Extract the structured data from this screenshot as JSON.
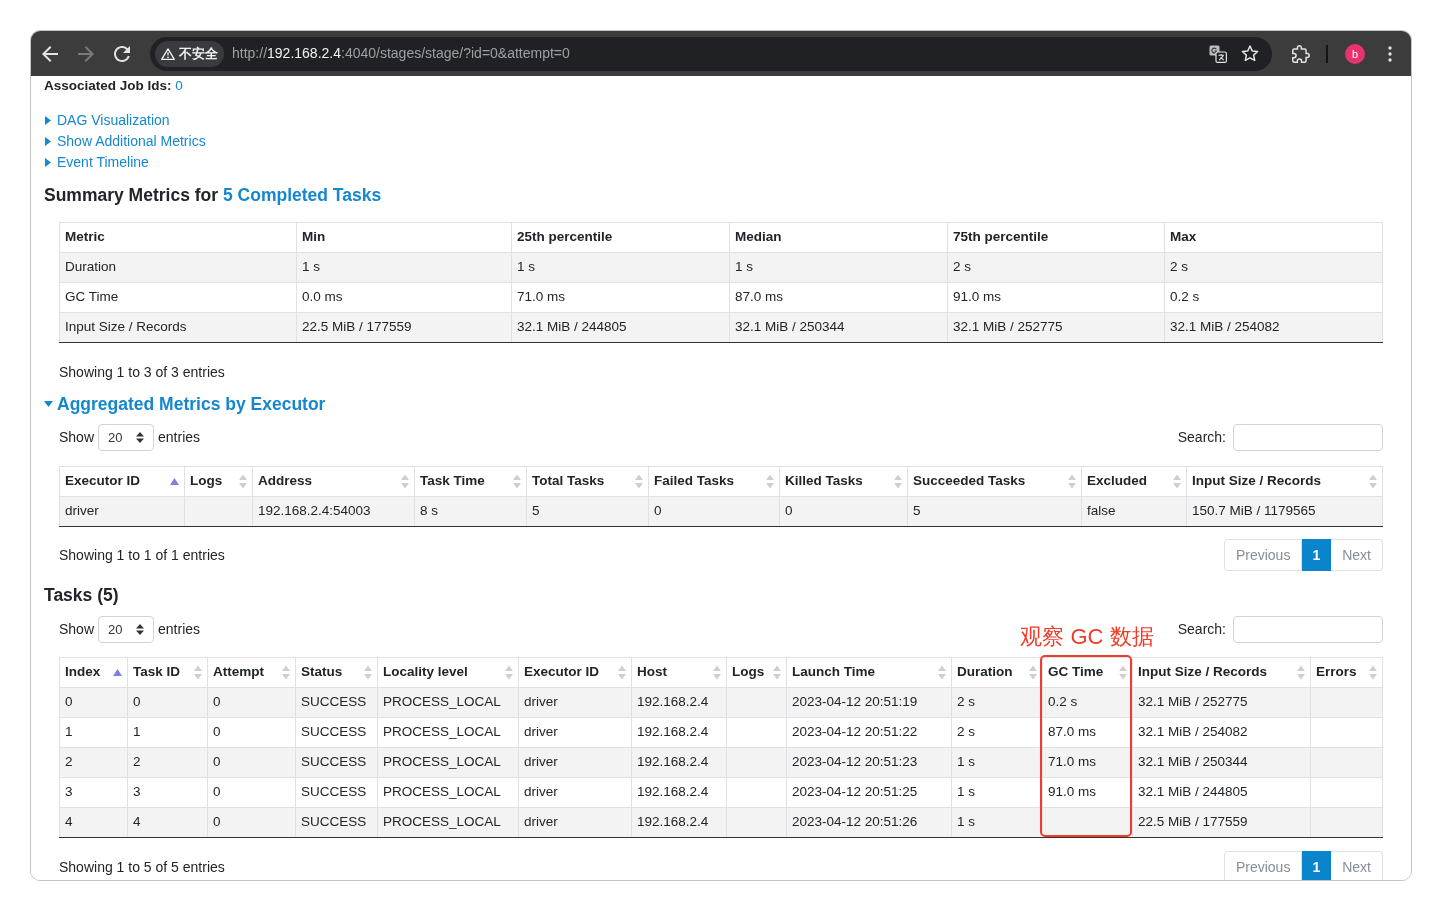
{
  "browser": {
    "back_enabled": true,
    "forward_enabled": false,
    "security_label": "不安全",
    "url": [
      {
        "text": "http://",
        "emphasis": false
      },
      {
        "text": "192.168.2.4",
        "emphasis": true
      },
      {
        "text": ":4040/stages/stage/?id=0&attempt=0",
        "emphasis": false
      }
    ],
    "bookmarked": false,
    "profile_initial": "b"
  },
  "job_ids": {
    "label": "Associated Job Ids:",
    "value": "0"
  },
  "toggles": [
    {
      "label": "DAG Visualization",
      "expanded": false
    },
    {
      "label": "Show Additional Metrics",
      "expanded": false
    },
    {
      "label": "Event Timeline",
      "expanded": false
    }
  ],
  "summary": {
    "title": "Summary Metrics for",
    "title_link": "5 Completed Tasks",
    "columns": [
      "Metric",
      "Min",
      "25th percentile",
      "Median",
      "75th percentile",
      "Max"
    ],
    "rows": [
      [
        "Duration",
        "1 s",
        "1 s",
        "1 s",
        "2 s",
        "2 s"
      ],
      [
        "GC Time",
        "0.0 ms",
        "71.0 ms",
        "87.0 ms",
        "91.0 ms",
        "0.2 s"
      ],
      [
        "Input Size / Records",
        "22.5 MiB / 177559",
        "32.1 MiB / 244805",
        "32.1 MiB / 250344",
        "32.1 MiB / 252775",
        "32.1 MiB / 254082"
      ]
    ],
    "info": "Showing 1 to 3 of 3 entries"
  },
  "executors": {
    "title": "Aggregated Metrics by Executor",
    "expanded": true,
    "length_menu": {
      "label": "Show",
      "value": "20",
      "suffix": "entries"
    },
    "search": {
      "label": "Search:"
    },
    "columns": [
      {
        "label": "Executor ID",
        "sorted_ascending": true
      },
      {
        "label": "Logs",
        "sorted_ascending": false
      },
      {
        "label": "Address",
        "sorted_ascending": false
      },
      {
        "label": "Task Time",
        "sorted_ascending": false
      },
      {
        "label": "Total Tasks",
        "sorted_ascending": false
      },
      {
        "label": "Failed Tasks",
        "sorted_ascending": false
      },
      {
        "label": "Killed Tasks",
        "sorted_ascending": false
      },
      {
        "label": "Succeeded Tasks",
        "sorted_ascending": false
      },
      {
        "label": "Excluded",
        "sorted_ascending": false
      },
      {
        "label": "Input Size / Records",
        "sorted_ascending": false
      }
    ],
    "rows": [
      [
        "driver",
        null,
        "192.168.2.4:54003",
        "8 s",
        "5",
        "0",
        "0",
        "5",
        "false",
        "150.7 MiB / 1179565"
      ]
    ],
    "info": "Showing 1 to 1 of 1 entries",
    "pagination": {
      "previous": {
        "label": "Previous",
        "disabled": true
      },
      "pages": [
        {
          "label": "1",
          "selected": true
        }
      ],
      "next": {
        "label": "Next",
        "disabled": true
      }
    }
  },
  "tasks": {
    "title": "Tasks (5)",
    "length_menu": {
      "label": "Show",
      "value": "20",
      "suffix": "entries"
    },
    "search": {
      "label": "Search:"
    },
    "columns": [
      {
        "label": "Index",
        "sorted_ascending": true,
        "highlighted": false
      },
      {
        "label": "Task ID",
        "sorted_ascending": false,
        "highlighted": false
      },
      {
        "label": "Attempt",
        "sorted_ascending": false,
        "highlighted": false
      },
      {
        "label": "Status",
        "sorted_ascending": false,
        "highlighted": false
      },
      {
        "label": "Locality level",
        "sorted_ascending": false,
        "highlighted": false
      },
      {
        "label": "Executor ID",
        "sorted_ascending": false,
        "highlighted": false
      },
      {
        "label": "Host",
        "sorted_ascending": false,
        "highlighted": false
      },
      {
        "label": "Logs",
        "sorted_ascending": false,
        "highlighted": false
      },
      {
        "label": "Launch Time",
        "sorted_ascending": false,
        "highlighted": false
      },
      {
        "label": "Duration",
        "sorted_ascending": false,
        "highlighted": false
      },
      {
        "label": "GC Time",
        "sorted_ascending": false,
        "highlighted": true
      },
      {
        "label": "Input Size / Records",
        "sorted_ascending": false,
        "highlighted": false
      },
      {
        "label": "Errors",
        "sorted_ascending": false,
        "highlighted": false
      }
    ],
    "rows": [
      [
        "0",
        "0",
        "0",
        "SUCCESS",
        "PROCESS_LOCAL",
        "driver",
        "192.168.2.4",
        null,
        "2023-04-12 20:51:19",
        "2 s",
        "0.2 s",
        "32.1 MiB / 252775",
        null
      ],
      [
        "1",
        "1",
        "0",
        "SUCCESS",
        "PROCESS_LOCAL",
        "driver",
        "192.168.2.4",
        null,
        "2023-04-12 20:51:22",
        "2 s",
        "87.0 ms",
        "32.1 MiB / 254082",
        null
      ],
      [
        "2",
        "2",
        "0",
        "SUCCESS",
        "PROCESS_LOCAL",
        "driver",
        "192.168.2.4",
        null,
        "2023-04-12 20:51:23",
        "1 s",
        "71.0 ms",
        "32.1 MiB / 250344",
        null
      ],
      [
        "3",
        "3",
        "0",
        "SUCCESS",
        "PROCESS_LOCAL",
        "driver",
        "192.168.2.4",
        null,
        "2023-04-12 20:51:25",
        "1 s",
        "91.0 ms",
        "32.1 MiB / 244805",
        null
      ],
      [
        "4",
        "4",
        "0",
        "SUCCESS",
        "PROCESS_LOCAL",
        "driver",
        "192.168.2.4",
        null,
        "2023-04-12 20:51:26",
        "1 s",
        null,
        "22.5 MiB / 177559",
        null
      ]
    ],
    "info": "Showing 1 to 5 of 5 entries",
    "pagination": {
      "previous": {
        "label": "Previous",
        "disabled": true
      },
      "pages": [
        {
          "label": "1",
          "selected": true
        }
      ],
      "next": {
        "label": "Next",
        "disabled": true
      }
    }
  },
  "annotation": {
    "text": "观察 GC 数据"
  }
}
